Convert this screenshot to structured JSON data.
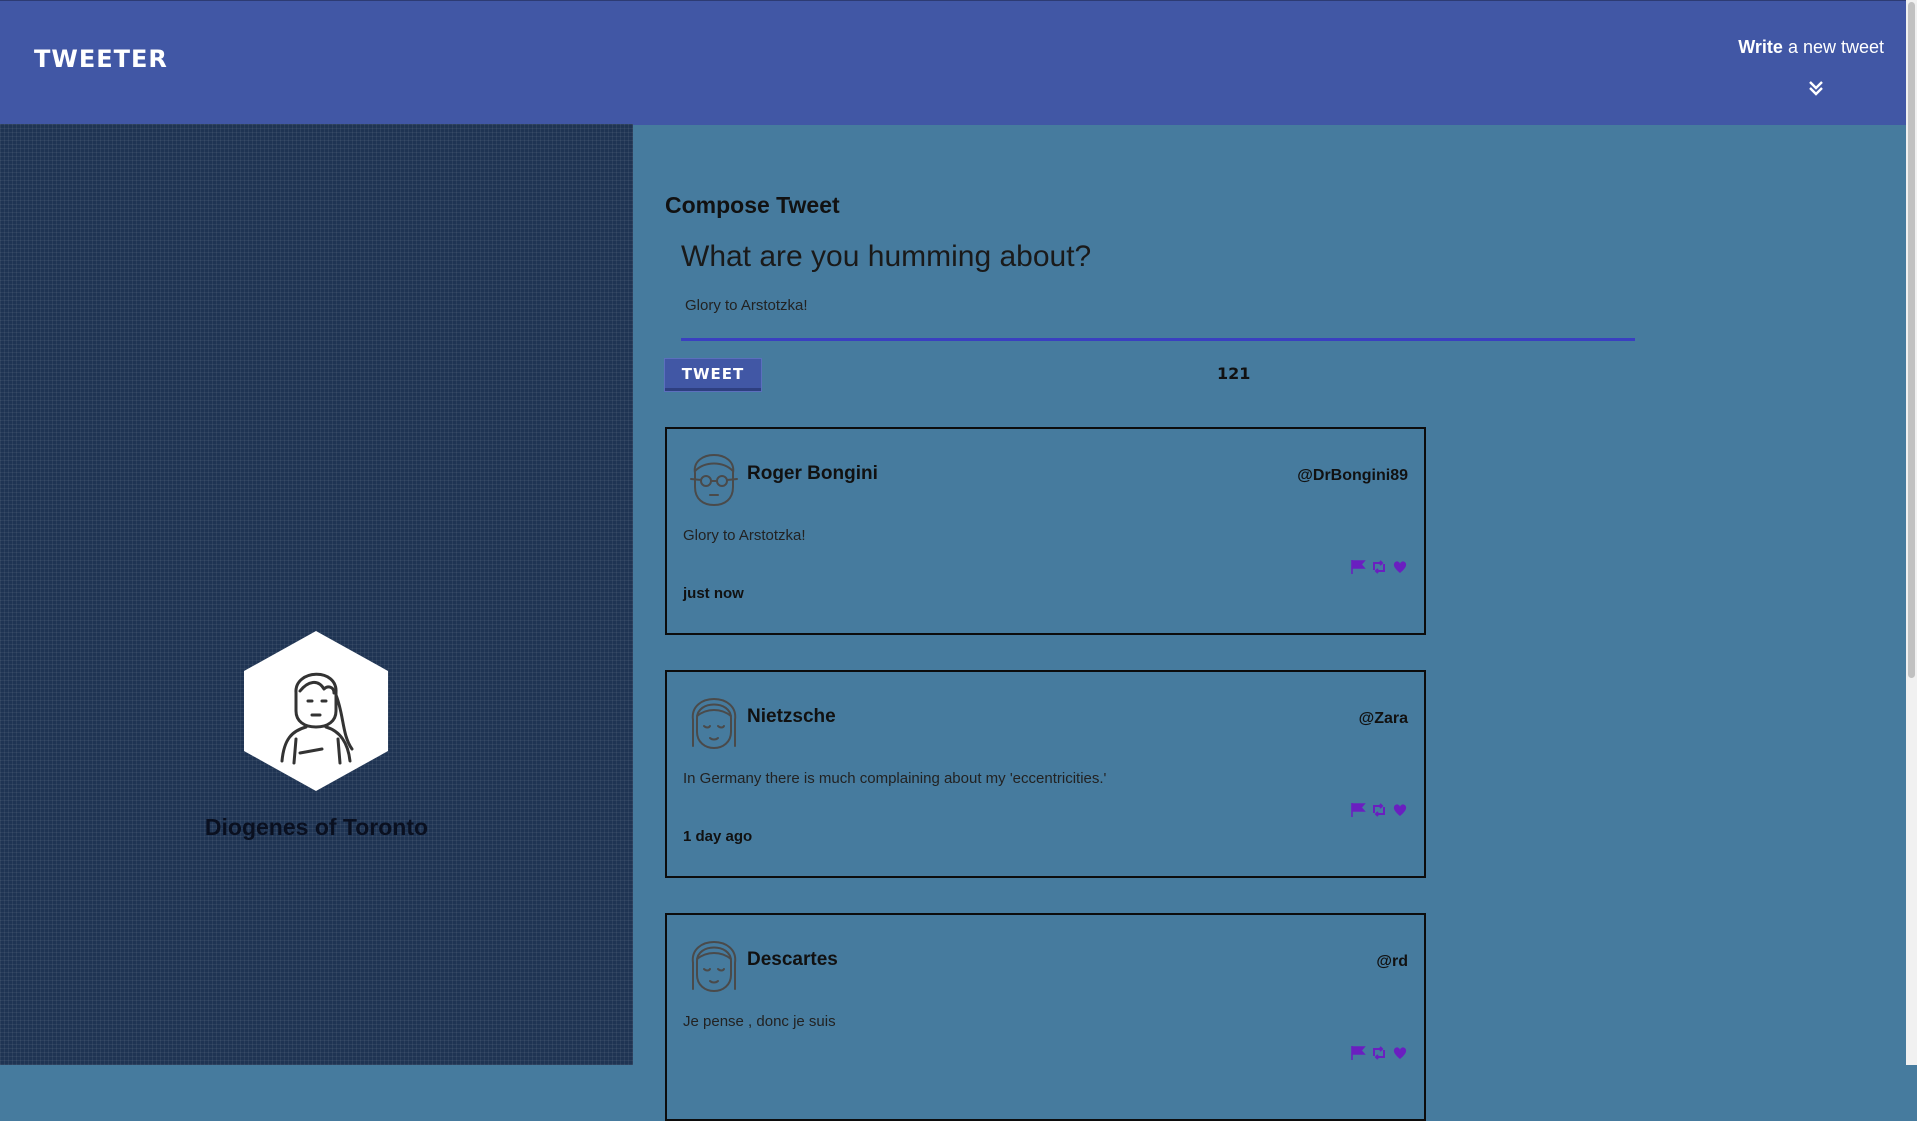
{
  "header": {
    "logo": "TWEETER",
    "write_strong": "Write",
    "write_rest": "a new tweet"
  },
  "profile": {
    "name": "Diogenes of Toronto"
  },
  "compose": {
    "title": "Compose Tweet",
    "label": "What are you humming about?",
    "text": "Glory to Arstotzka!",
    "button": "TWEET",
    "counter": "121"
  },
  "tweets": [
    {
      "name": "Roger Bongini",
      "handle": "@DrBongini89",
      "content": "Glory to Arstotzka!",
      "time": "just now"
    },
    {
      "name": "Nietzsche",
      "handle": "@Zara",
      "content": "In Germany there is much complaining about my 'eccentricities.'",
      "time": "1 day ago"
    },
    {
      "name": "Descartes",
      "handle": "@rd",
      "content": "Je pense , donc je suis",
      "time": ""
    }
  ],
  "icons": {
    "chevron": "double-chevron-down-icon",
    "flag": "flag-icon",
    "retweet": "retweet-icon",
    "like": "heart-icon"
  },
  "colors": {
    "header_bg": "#4157a5",
    "main_bg": "#467b9e",
    "profile_bg": "#1f3453",
    "action_icons": "#6a1fc0"
  }
}
